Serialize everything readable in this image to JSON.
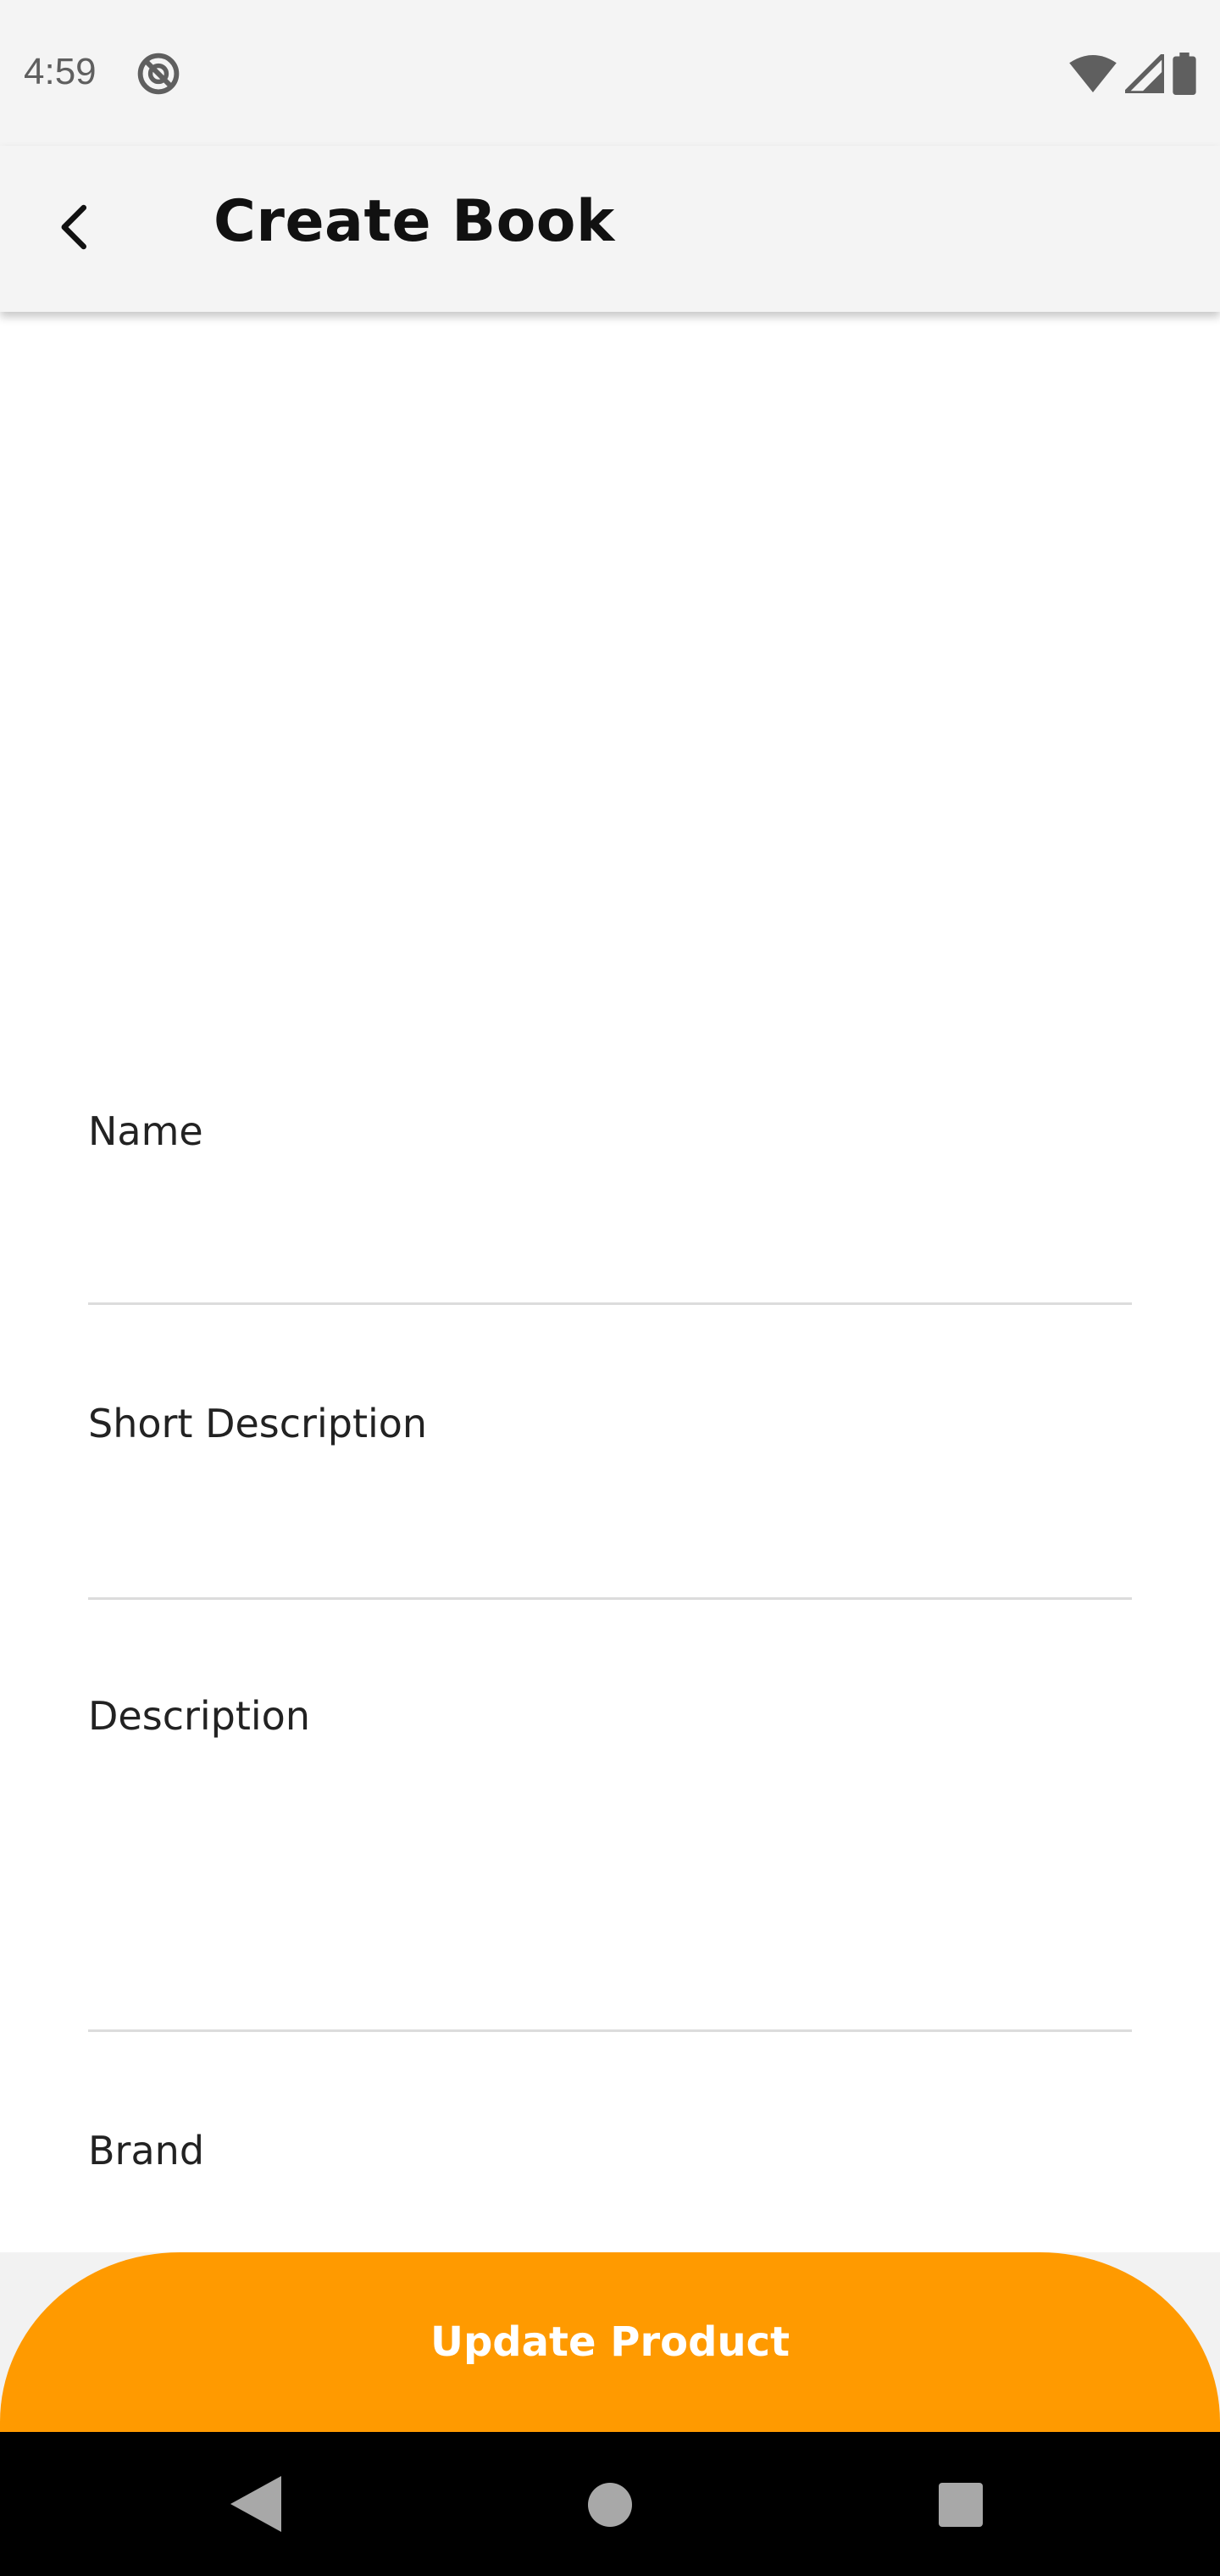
{
  "status_bar": {
    "time": "4:59",
    "icons": [
      "do-not-disturb-icon",
      "wifi-icon",
      "cellular-signal-icon",
      "battery-icon"
    ]
  },
  "app_bar": {
    "title": "Create Book",
    "back_icon": "chevron-left-icon"
  },
  "form": {
    "fields": [
      {
        "label": "Name",
        "value": ""
      },
      {
        "label": "Short Description",
        "value": ""
      },
      {
        "label": "Description",
        "value": ""
      },
      {
        "label": "Brand",
        "value": ""
      }
    ]
  },
  "actions": {
    "submit_label": "Update Product"
  },
  "colors": {
    "accent": "#ff9a00",
    "app_bar_bg": "#f4f4f4",
    "divider": "#dcdcdc",
    "nav_bar_bg": "#000000"
  },
  "navigation_bar": {
    "icons": [
      "nav-back-icon",
      "nav-home-icon",
      "nav-recents-icon"
    ]
  }
}
